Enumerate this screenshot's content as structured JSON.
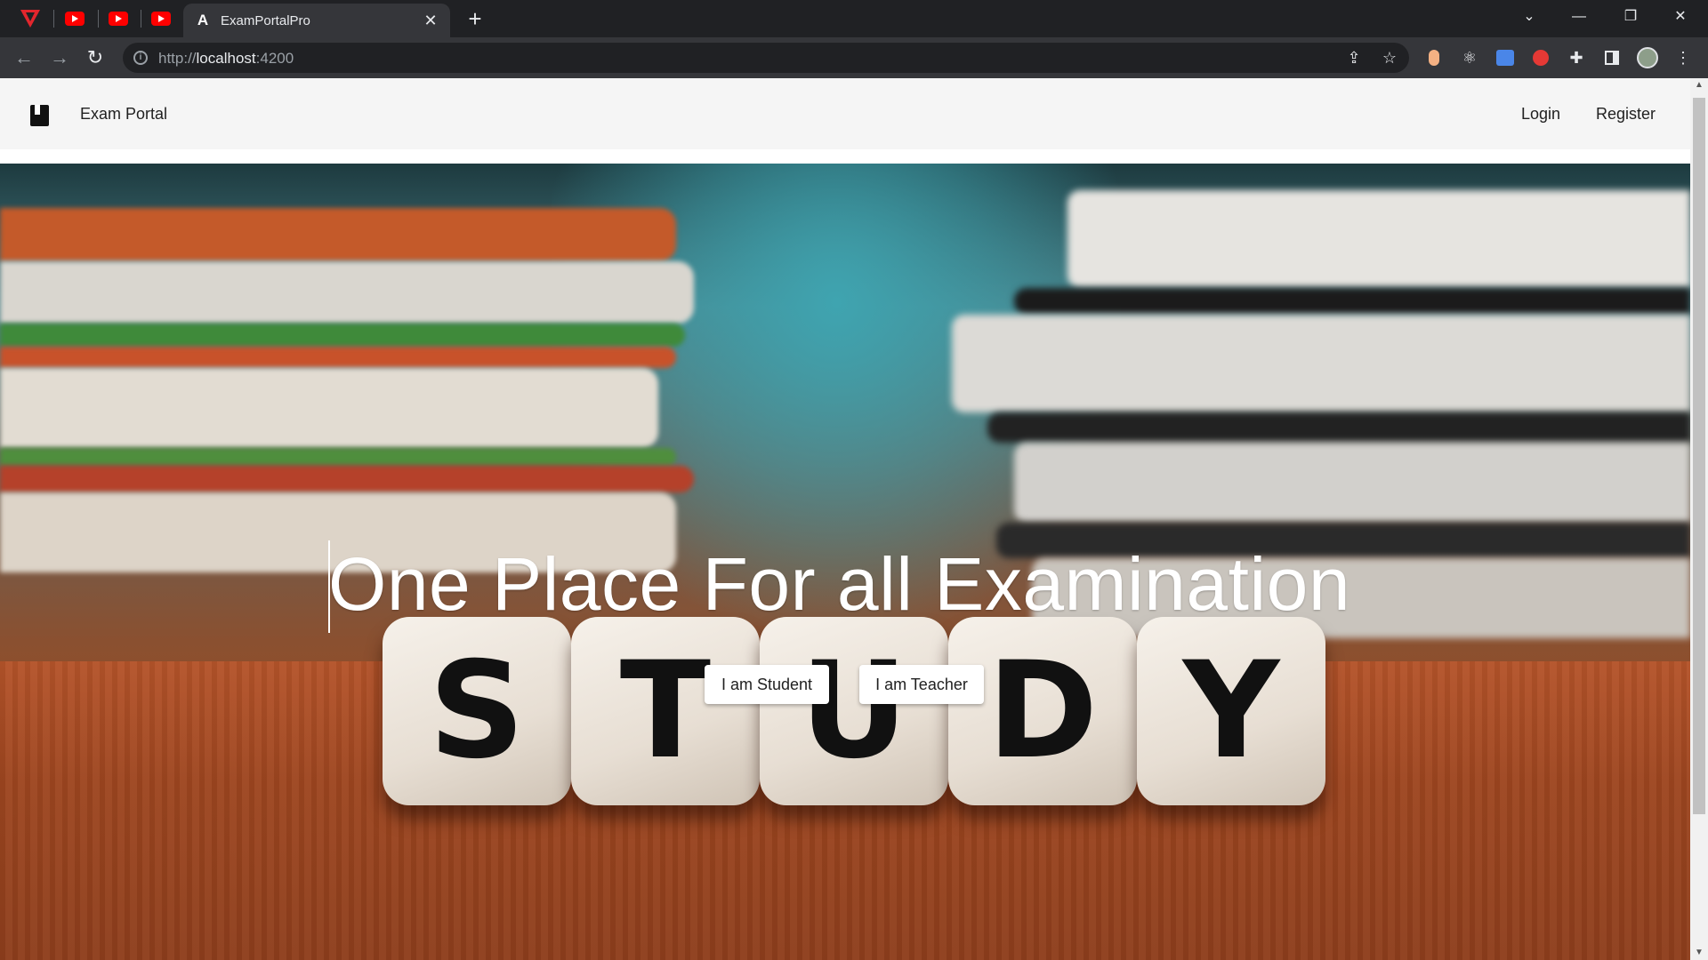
{
  "browser": {
    "pinned_tabs": [
      {
        "icon": "vivaldi-v-icon"
      },
      {
        "icon": "youtube-icon"
      },
      {
        "icon": "youtube-icon"
      },
      {
        "icon": "youtube-icon"
      }
    ],
    "active_tab": {
      "title": "ExamPortalPro",
      "favicon": "angular-a-icon"
    },
    "new_tab_label": "+",
    "url": {
      "scheme": "http://",
      "host": "localhost",
      "port": ":4200"
    },
    "window_controls": [
      "tab-search-icon",
      "minimize-icon",
      "restore-icon",
      "close-icon"
    ],
    "extensions": [
      "hand-extension-icon",
      "react-devtools-icon",
      "translate-icon",
      "stop-hand-icon",
      "puzzle-icon",
      "side-panel-icon",
      "profile-avatar",
      "kebab-menu-icon"
    ]
  },
  "app": {
    "brand": {
      "name": "Exam Portal",
      "icon": "book-icon"
    },
    "nav": [
      {
        "label": "Login"
      },
      {
        "label": "Register"
      }
    ]
  },
  "hero": {
    "headline": "One Place For all Examination",
    "dice_letters": [
      "S",
      "T",
      "U",
      "D",
      "Y"
    ],
    "buttons": [
      {
        "label": "I am Student"
      },
      {
        "label": "I am Teacher"
      }
    ]
  },
  "colors": {
    "browser_bg": "#202124",
    "toolbar_bg": "#35363a",
    "appbar_bg": "#f5f5f5",
    "headline": "#ffffff",
    "button_bg": "#ffffff"
  }
}
